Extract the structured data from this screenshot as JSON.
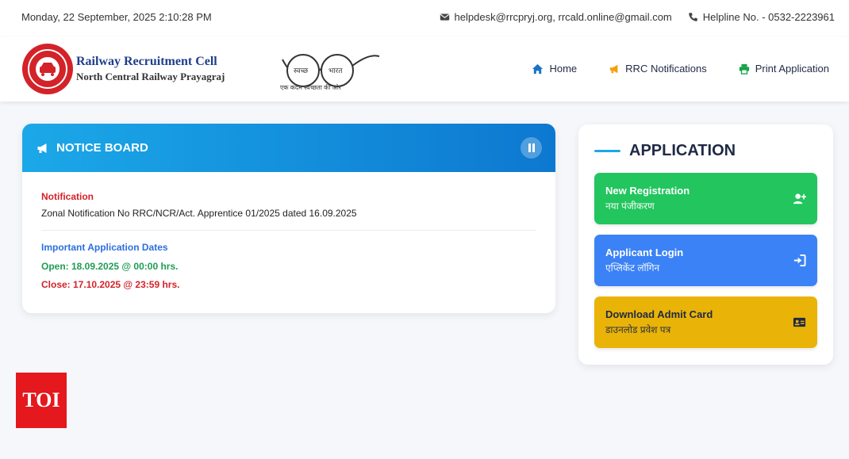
{
  "topbar": {
    "datetime": "Monday, 22 September, 2025 2:10:28 PM",
    "email": "helpdesk@rrcpryj.org, rrcald.online@gmail.com",
    "helpline": "Helpline No. - 0532-2223961"
  },
  "header": {
    "org_title": "Railway Recruitment Cell",
    "org_subtitle": "North Central Railway Prayagraj",
    "swachh_left": "स्वच्छ",
    "swachh_right": "भारत",
    "swachh_tagline": "एक कदम स्वच्छता की ओर"
  },
  "nav": {
    "home": "Home",
    "notifications": "RRC Notifications",
    "print": "Print Application"
  },
  "notice_board": {
    "title": "NOTICE BOARD",
    "notification_label": "Notification",
    "notification_text": "Zonal Notification No RRC/NCR/Act. Apprentice 01/2025 dated 16.09.2025",
    "dates_label": "Important Application Dates",
    "open": "Open: 18.09.2025 @ 00:00 hrs.",
    "close": "Close: 17.10.2025 @ 23:59 hrs."
  },
  "application": {
    "title": "APPLICATION",
    "buttons": [
      {
        "title": "New Registration",
        "subtitle": "नया पंजीकरण",
        "color": "#22c55e",
        "icon": "add-user-icon"
      },
      {
        "title": "Applicant Login",
        "subtitle": "एप्लिकेंट लॉगिन",
        "color": "#3b82f6",
        "icon": "sign-in-icon"
      },
      {
        "title": "Download Admit Card",
        "subtitle": "डाउनलोड प्रवेश पत्र",
        "color": "#eab308",
        "icon": "id-card-icon"
      }
    ]
  },
  "watermark": {
    "text": "TOI"
  }
}
